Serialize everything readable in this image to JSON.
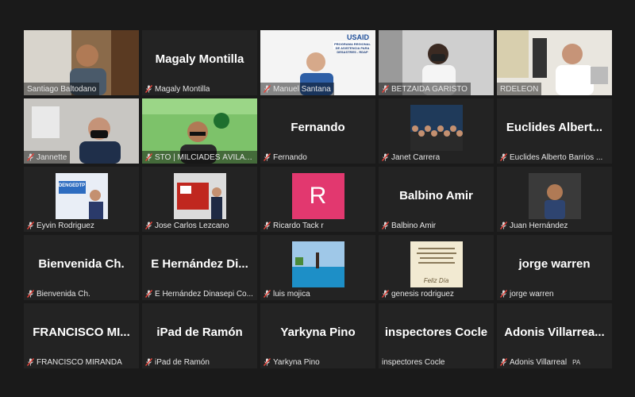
{
  "participants": [
    {
      "name": "Santiago Baltodano",
      "muted": false,
      "kind": "video",
      "scene": "office-man"
    },
    {
      "name": "Magaly Montilla",
      "muted": true,
      "kind": "name",
      "big": "Magaly Montilla"
    },
    {
      "name": "Manuel Santana",
      "muted": true,
      "kind": "video",
      "scene": "usaid-man",
      "logo": "USAID",
      "caption": "PROGRAMA REGIONAL DE ASISTENCIA PARA DESASTRES - RDAP"
    },
    {
      "name": "BETZAIDA GARISTO",
      "muted": true,
      "kind": "video",
      "scene": "woman-mask"
    },
    {
      "name": "RDELEON",
      "muted": false,
      "kind": "video",
      "scene": "doctor",
      "active": true
    },
    {
      "name": "Jannette",
      "muted": true,
      "kind": "video",
      "scene": "woman-office"
    },
    {
      "name": "STO | MILCIADES ÁVILA P...",
      "muted": true,
      "kind": "video",
      "scene": "man-green"
    },
    {
      "name": "Fernando",
      "muted": true,
      "kind": "name",
      "big": "Fernando"
    },
    {
      "name": "Janet Carrera",
      "muted": true,
      "kind": "thumb",
      "scene": "group-photo"
    },
    {
      "name": "Euclides Alberto Barrios ...",
      "muted": true,
      "kind": "name",
      "big": "Euclides  Albert..."
    },
    {
      "name": "Eyvin Rodriguez",
      "muted": true,
      "kind": "thumb",
      "scene": "dengue",
      "caption": "DENGEDTP"
    },
    {
      "name": "Jose Carlos Lezcano",
      "muted": true,
      "kind": "thumb",
      "scene": "ambulance"
    },
    {
      "name": "Ricardo Tack r",
      "muted": true,
      "kind": "thumb",
      "scene": "avatar-r",
      "letter": "R"
    },
    {
      "name": "Balbino Amir",
      "muted": true,
      "kind": "name",
      "big": "Balbino Amir"
    },
    {
      "name": "Juan Hernández",
      "muted": true,
      "kind": "thumb",
      "scene": "car-man"
    },
    {
      "name": "Bienvenida Ch.",
      "muted": true,
      "kind": "name",
      "big": "Bienvenida Ch."
    },
    {
      "name": "E Hernández Dinasepi Co...",
      "muted": true,
      "kind": "name",
      "big": "E Hernández Di..."
    },
    {
      "name": "luis mojica",
      "muted": true,
      "kind": "thumb",
      "scene": "pool"
    },
    {
      "name": "genesis rodriguez",
      "muted": true,
      "kind": "thumb",
      "scene": "card",
      "caption": "Feliz Día"
    },
    {
      "name": "jorge warren",
      "muted": true,
      "kind": "name",
      "big": "jorge warren"
    },
    {
      "name": "FRANCISCO MIRANDA",
      "muted": true,
      "kind": "name",
      "big": "FRANCISCO  MI..."
    },
    {
      "name": "iPad de Ramón",
      "muted": true,
      "kind": "name",
      "big": "iPad de Ramón"
    },
    {
      "name": "Yarkyna Pino",
      "muted": true,
      "kind": "name",
      "big": "Yarkyna Pino"
    },
    {
      "name": "inspectores Cocle",
      "muted": false,
      "kind": "name",
      "big": "inspectores Cocle"
    },
    {
      "name": "Adonis Villarreal",
      "muted": true,
      "kind": "name",
      "big": "Adonis  Villarrea...",
      "extra": "PA"
    }
  ],
  "colors": {
    "bg": "#1a1a1a",
    "tile": "#232323",
    "active": "#e8e04a",
    "mic": "#e8453c",
    "avatar": "#e2386f"
  }
}
